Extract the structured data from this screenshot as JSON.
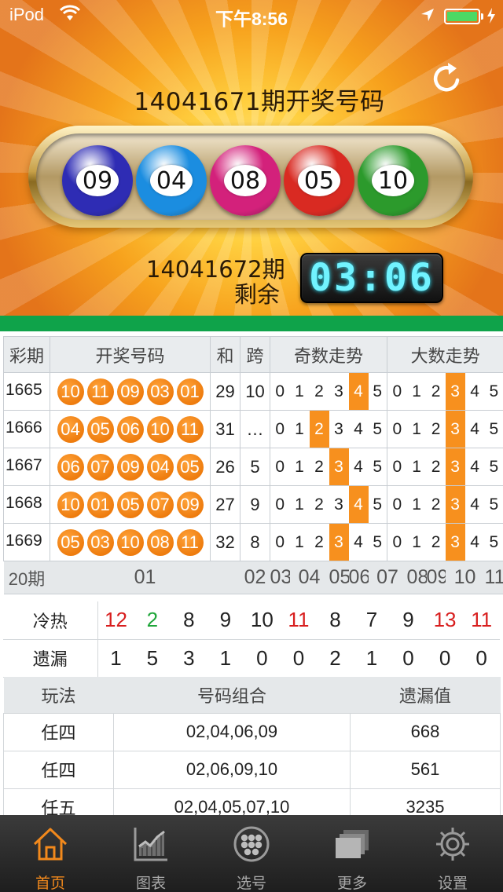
{
  "status_bar": {
    "carrier": "iPod",
    "time": "下午8:56"
  },
  "header": {
    "draw_title": "14041671期开奖号码",
    "balls": [
      {
        "number": "09",
        "color": "#2e2cb4"
      },
      {
        "number": "04",
        "color": "#1b8de0"
      },
      {
        "number": "08",
        "color": "#d3217b"
      },
      {
        "number": "05",
        "color": "#d92a22"
      },
      {
        "number": "10",
        "color": "#2c9a2c"
      }
    ],
    "next_period": "14041672期",
    "remain_label": "剩余",
    "countdown": "03:06"
  },
  "trend": {
    "headers": {
      "period": "彩期",
      "numbers": "开奖号码",
      "sum": "和",
      "span": "跨",
      "odd_trend": "奇数走势",
      "big_trend": "大数走势"
    },
    "digits": [
      "0",
      "1",
      "2",
      "3",
      "4",
      "5"
    ],
    "rows": [
      {
        "period": "1665",
        "nums": [
          "10",
          "11",
          "09",
          "03",
          "01"
        ],
        "sum": "29",
        "span": "10",
        "odd": 4,
        "big": 3
      },
      {
        "period": "1666",
        "nums": [
          "04",
          "05",
          "06",
          "10",
          "11"
        ],
        "sum": "31",
        "span": "…",
        "odd": 2,
        "big": 3
      },
      {
        "period": "1667",
        "nums": [
          "06",
          "07",
          "09",
          "04",
          "05"
        ],
        "sum": "26",
        "span": "5",
        "odd": 3,
        "big": 3
      },
      {
        "period": "1668",
        "nums": [
          "10",
          "01",
          "05",
          "07",
          "09"
        ],
        "sum": "27",
        "span": "9",
        "odd": 4,
        "big": 3
      },
      {
        "period": "1669",
        "nums": [
          "05",
          "03",
          "10",
          "08",
          "11"
        ],
        "sum": "32",
        "span": "8",
        "odd": 3,
        "big": 3
      }
    ],
    "footer": {
      "label": "20期",
      "numbers": [
        "01",
        "02",
        "03",
        "04",
        "05",
        "06",
        "07",
        "08",
        "09",
        "10",
        "11"
      ]
    }
  },
  "cold_hot": {
    "hot_label": "冷热",
    "hot_values": [
      "12",
      "2",
      "8",
      "9",
      "10",
      "11",
      "8",
      "7",
      "9",
      "13",
      "11"
    ],
    "hot_colors": [
      "red",
      "green",
      "",
      "",
      "",
      "red",
      "",
      "",
      "",
      "red",
      "red"
    ],
    "miss_label": "遗漏",
    "miss_values": [
      "1",
      "5",
      "3",
      "1",
      "0",
      "0",
      "2",
      "1",
      "0",
      "0",
      "0"
    ]
  },
  "play": {
    "headers": {
      "type": "玩法",
      "combo": "号码组合",
      "miss": "遗漏值"
    },
    "rows": [
      {
        "type": "任四",
        "combo": "02,04,06,09",
        "miss": "668"
      },
      {
        "type": "任四",
        "combo": "02,06,09,10",
        "miss": "561"
      },
      {
        "type": "任五",
        "combo": "02,04,05,07,10",
        "miss": "3235"
      }
    ]
  },
  "tabbar": {
    "tabs": [
      {
        "label": "首页",
        "icon": "home-icon",
        "active": true
      },
      {
        "label": "图表",
        "icon": "chart-icon",
        "active": false
      },
      {
        "label": "选号",
        "icon": "pick-number-icon",
        "active": false
      },
      {
        "label": "更多",
        "icon": "more-icon",
        "active": false
      },
      {
        "label": "设置",
        "icon": "settings-icon",
        "active": false
      }
    ]
  },
  "colors": {
    "accent": "#f7901e",
    "header_green": "#0fa34a",
    "tab_active": "#f2891c",
    "countdown": "#71f3ff"
  }
}
